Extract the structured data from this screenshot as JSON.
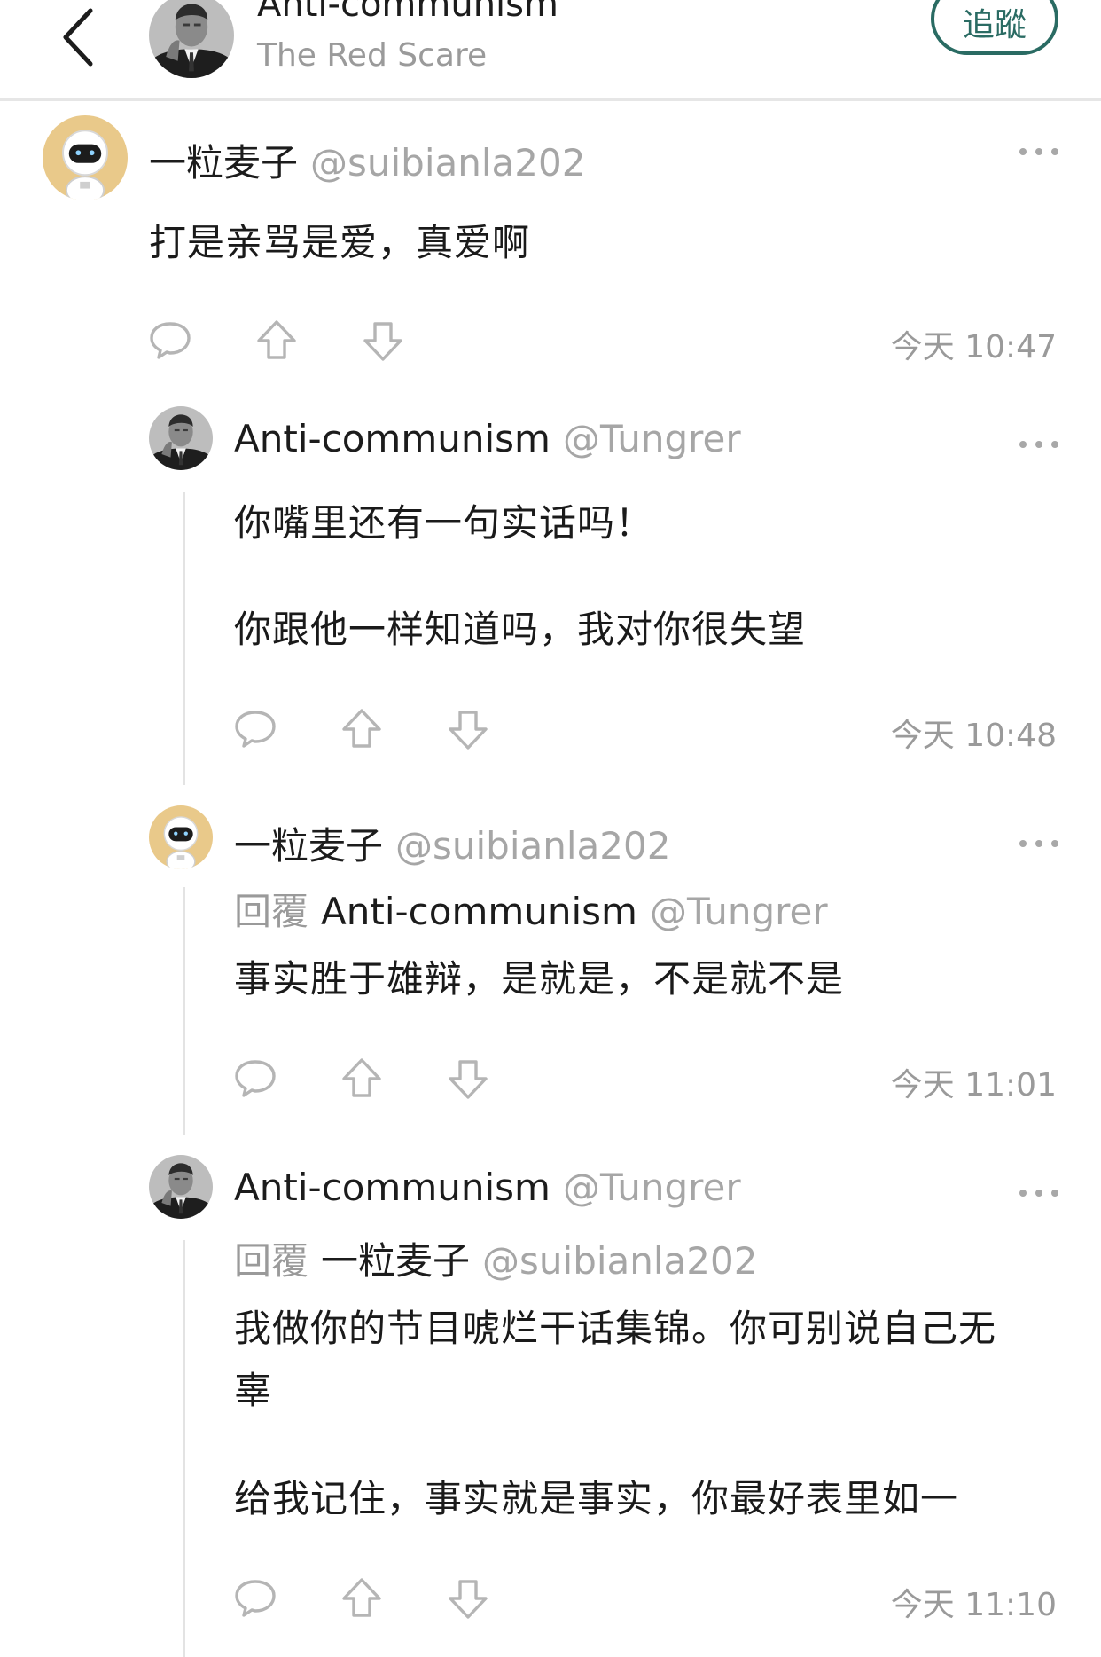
{
  "header": {
    "title": "Anti-communism",
    "subtitle": "The Red Scare",
    "follow_label": "追蹤"
  },
  "comments": [
    {
      "author": "一粒麦子",
      "handle": "@suibianla202",
      "avatar": "astronaut",
      "paragraphs": [
        "打是亲骂是爱，真爱啊"
      ],
      "timestamp": "今天 10:47"
    },
    {
      "author": "Anti-communism",
      "handle": "@Tungrer",
      "avatar": "man-portrait",
      "paragraphs": [
        "你嘴里还有一句实话吗！",
        "你跟他一样知道吗，我对你很失望"
      ],
      "timestamp": "今天 10:48"
    },
    {
      "author": "一粒麦子",
      "handle": "@suibianla202",
      "avatar": "astronaut",
      "reply_prefix": "回覆",
      "reply_to_name": "Anti-communism",
      "reply_to_handle": "@Tungrer",
      "paragraphs": [
        "事实胜于雄辩，是就是，不是就不是"
      ],
      "timestamp": "今天 11:01"
    },
    {
      "author": "Anti-communism",
      "handle": "@Tungrer",
      "avatar": "man-portrait",
      "reply_prefix": "回覆",
      "reply_to_name": "一粒麦子",
      "reply_to_handle": "@suibianla202",
      "paragraphs": [
        "我做你的节目唬烂干话集锦。你可别说自己无",
        "辜",
        "给我记住，事实就是事实，你最好表里如一"
      ],
      "timestamp": "今天 11:10"
    }
  ],
  "icons": {
    "reply": "comment-bubble-icon",
    "upvote": "upvote-arrow-icon",
    "downvote": "downvote-arrow-icon",
    "more": "more-dots-icon",
    "back": "chevron-left-icon"
  },
  "colors": {
    "accent": "#2a6b63",
    "muted": "#9a9a9a",
    "icon": "#b5b5b5",
    "thread": "#e3e3e3"
  }
}
